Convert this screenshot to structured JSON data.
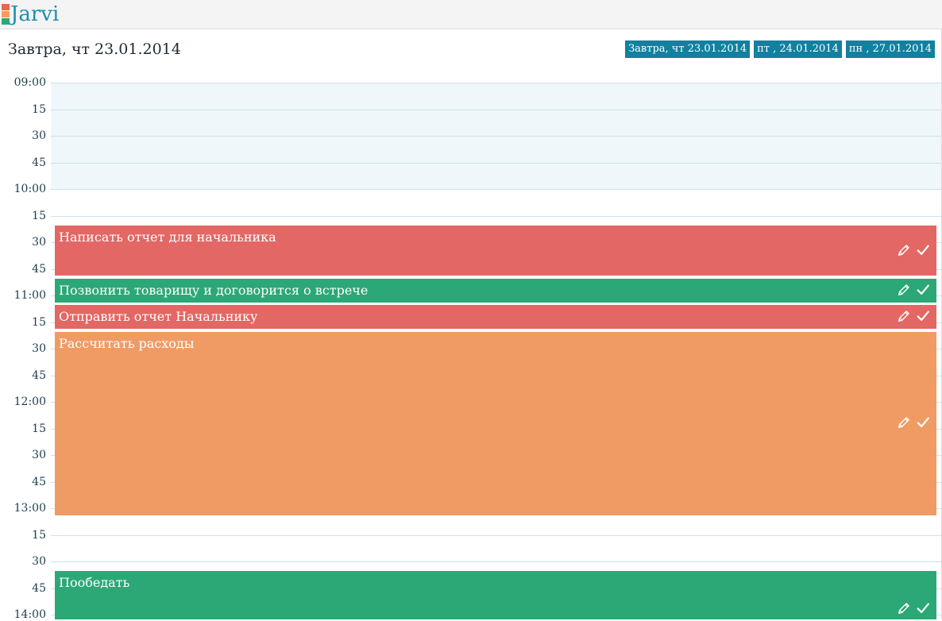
{
  "app": {
    "logo_text": "Jarvi",
    "logo_colors": [
      "#e8664e",
      "#f1a05a",
      "#2ba87a"
    ]
  },
  "header": {
    "title": "Завтра, чт 23.01.2014",
    "tabs": [
      {
        "label": "Завтра, чт 23.01.2014"
      },
      {
        "label": "пт , 24.01.2014"
      },
      {
        "label": "пн , 27.01.2014"
      }
    ]
  },
  "time_labels": [
    "09:00",
    "15",
    "30",
    "45",
    "10:00",
    "15",
    "30",
    "45",
    "11:00",
    "15",
    "30",
    "45",
    "12:00",
    "15",
    "30",
    "45",
    "13:00",
    "15",
    "30",
    "45",
    "14:00"
  ],
  "events": [
    {
      "title": "Написать отчет для начальника",
      "color": "#e36764",
      "start": "10:15",
      "end": "10:30"
    },
    {
      "title": "Позвонить товарищу и договорится о встрече",
      "color": "#2ca877",
      "start": "10:45",
      "end": "10:45"
    },
    {
      "title": "Отправить отчет Начальнику",
      "color": "#e36764",
      "start": "11:00",
      "end": "11:00"
    },
    {
      "title": "Рассчитать расходы",
      "color": "#f09b64",
      "start": "11:15",
      "end": "12:45"
    },
    {
      "title": "Пообедать",
      "color": "#2ca877",
      "start": "13:30",
      "end": "14:00"
    }
  ],
  "icons": {
    "edit": "pencil-icon",
    "done": "check-icon"
  },
  "colors": {
    "accent": "#12809f",
    "highlight": "#eff7fa",
    "gridline": "#c9e3ea"
  }
}
